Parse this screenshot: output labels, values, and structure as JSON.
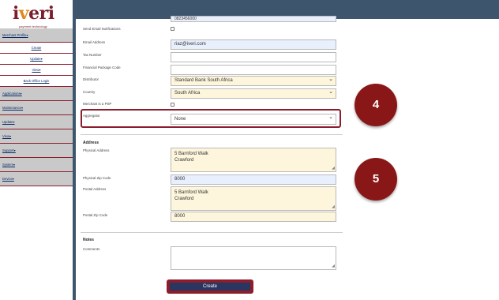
{
  "brand": {
    "logo": "iveri",
    "tagline": "payment technology"
  },
  "sidebar": {
    "items": [
      {
        "label": "Merchant Profile▾",
        "kind": "main"
      },
      {
        "label": "Create",
        "kind": "sub"
      },
      {
        "label": "Update▾",
        "kind": "main"
      },
      {
        "label": "View▾",
        "kind": "main"
      },
      {
        "label": "Back Office Login",
        "kind": "sub"
      },
      {
        "label": "Applications▾",
        "kind": "main"
      },
      {
        "label": "Maintenance▾",
        "kind": "main"
      },
      {
        "label": "Update▾",
        "kind": "main"
      },
      {
        "label": "View▾",
        "kind": "main"
      },
      {
        "label": "Support▾",
        "kind": "main"
      },
      {
        "label": "System▾",
        "kind": "main"
      },
      {
        "label": "Device▾",
        "kind": "main"
      }
    ]
  },
  "form": {
    "top_value": "0823456000",
    "send_email_label": "Send Email Notifications",
    "email_label": "Email Address",
    "email_value": "riaz@iveri.com",
    "tax_label": "Tax Number",
    "financial_label": "Financial Package Code",
    "distributor_label": "Distributor",
    "distributor_value": "Standard Bank South Africa",
    "country_label": "Country",
    "country_value": "South Africa",
    "psp_label": "Merchant is a PSP",
    "aggregator_label": "Aggregator",
    "aggregator_value": "None",
    "address_title": "Address",
    "physical_address_label": "Physical Address",
    "physical_address_line1": "5 Barnford Walk",
    "physical_address_line2": "Crawford",
    "physical_zip_label": "Physical Zip Code",
    "physical_zip_value": "8000",
    "postal_address_label": "Postal Address",
    "postal_address_line1": "5 Barnford Walk",
    "postal_address_line2": "Crawford",
    "postal_zip_label": "Postal Zip Code",
    "postal_zip_value": "8000",
    "notes_title": "Notes",
    "comments_label": "Comments",
    "create_label": "Create"
  },
  "callouts": {
    "step4": "4",
    "step5": "5"
  },
  "colors": {
    "topbar": "#3d566e",
    "accent": "#8b1d2c",
    "button": "#2a3560",
    "badge": "#8a1717"
  }
}
